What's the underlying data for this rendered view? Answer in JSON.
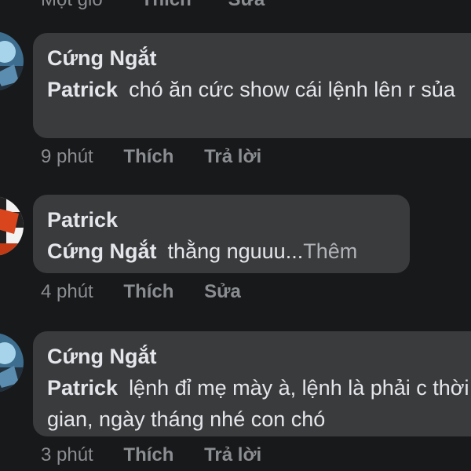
{
  "top_partial": {
    "time": "Một giờ",
    "like": "Thích",
    "edit": "Sửa"
  },
  "comments": [
    {
      "author": "Cứng Ngắt",
      "mention": "Patrick",
      "text": "chó ăn cức show cái lệnh lên r sủa",
      "time": "9 phút",
      "like": "Thích",
      "action": "Trả lời"
    },
    {
      "author": "Patrick",
      "mention": "Cứng Ngắt",
      "text": "thằng nguuu...",
      "more": "Thêm",
      "time": "4 phút",
      "like": "Thích",
      "action": "Sửa"
    },
    {
      "author": "Cứng Ngắt",
      "mention": "Patrick",
      "text": "lệnh đỉ mẹ mày à, lệnh là phải c thời gian, ngày tháng nhé con chó",
      "time": "3 phút",
      "like": "Thích",
      "action": "Trả lời"
    }
  ],
  "colors": {
    "background": "#18191a",
    "bubble": "#3a3b3c",
    "text": "#e4e6eb",
    "muted": "#8a8d91"
  }
}
